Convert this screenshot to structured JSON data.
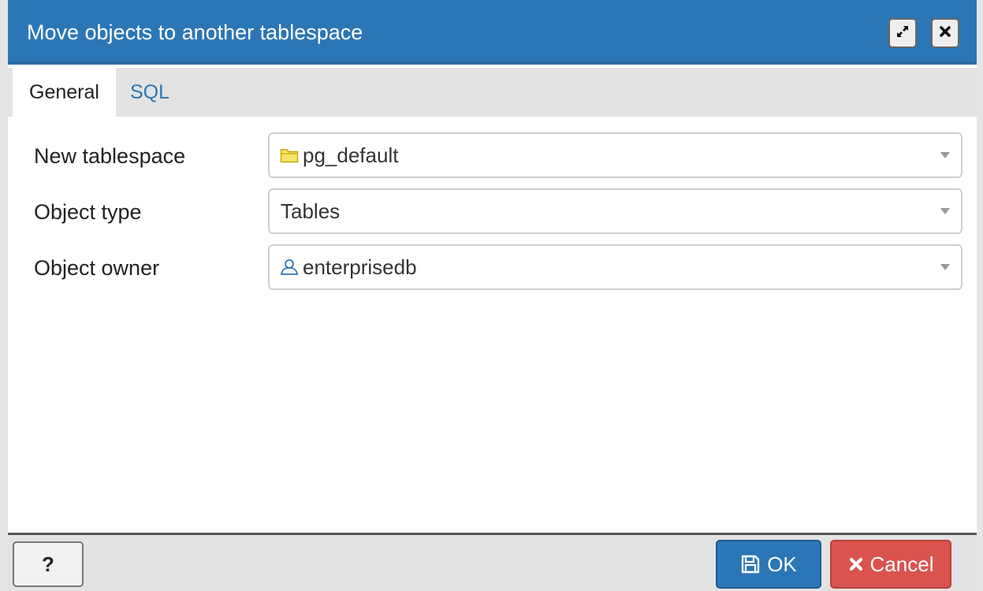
{
  "dialog": {
    "title": "Move objects to another tablespace",
    "maximize_icon": "expand-icon",
    "close_icon": "close-icon"
  },
  "tabs": [
    {
      "label": "General",
      "active": true
    },
    {
      "label": "SQL",
      "active": false
    }
  ],
  "form": {
    "new_tablespace": {
      "label": "New tablespace",
      "value": "pg_default",
      "icon": "folder-icon"
    },
    "object_type": {
      "label": "Object type",
      "value": "Tables"
    },
    "object_owner": {
      "label": "Object owner",
      "value": "enterprisedb",
      "icon": "user-icon"
    }
  },
  "footer": {
    "help_label": "?",
    "ok_label": "OK",
    "ok_icon": "save-icon",
    "cancel_label": "Cancel",
    "cancel_icon": "times-icon"
  },
  "colors": {
    "titlebar": "#2c76b6",
    "primary": "#2c76b6",
    "danger": "#d9534f",
    "folder": "#f5e56b",
    "user_icon": "#2c76b6"
  }
}
